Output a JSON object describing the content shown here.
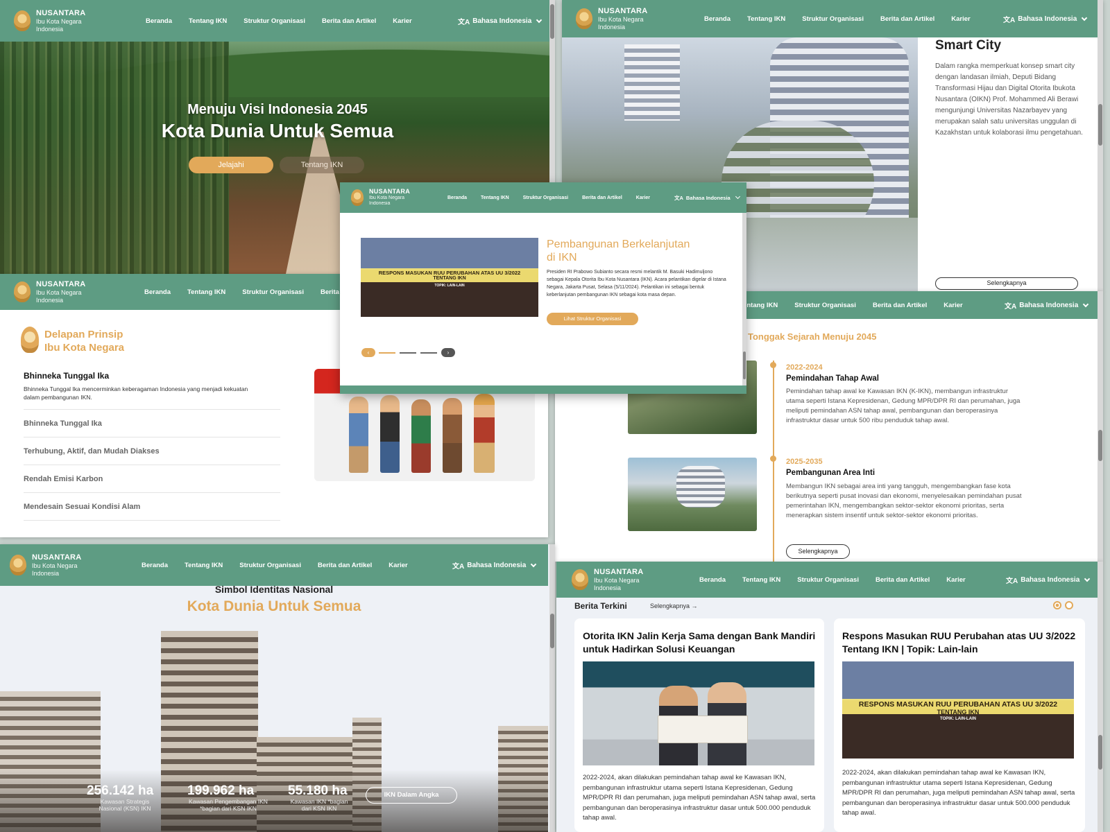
{
  "nav": {
    "logo_title": "NUSANTARA",
    "logo_sub1": "Ibu Kota Negara",
    "logo_sub2": "Indonesia",
    "menu": [
      "Beranda",
      "Tentang IKN",
      "Struktur Organisasi",
      "Berita dan Artikel",
      "Karier"
    ],
    "language": "Bahasa Indonesia"
  },
  "hero": {
    "subtitle": "Menuju Visi Indonesia 2045",
    "title": "Kota Dunia Untuk Semua",
    "primary_button": "Jelajahi",
    "secondary_button": "Tentang IKN"
  },
  "smart_city": {
    "title": "Smart City",
    "body": "Dalam rangka memperkuat konsep smart city dengan landasan ilmiah, Deputi Bidang Transformasi Hijau dan Digital Otorita Ibukota Nusantara (OIKN) Prof. Mohammed Ali Berawi mengunjungi Universitas Nazarbayev yang merupakan salah satu universitas unggulan di Kazakhstan untuk kolaborasi ilmu pengetahuan.",
    "button": "Selengkapnya"
  },
  "pembangunan": {
    "title_line1": "Pembangunan Berkelanjutan",
    "title_line2": "di IKN",
    "body": "Presiden RI Prabowo Subianto secara resmi melantik M. Basuki Hadimuljono sebagai Kepala Otorita Ibu Kota Nusantara (IKN). Acara pelantikan digelar di Istana Negara, Jakarta Pusat, Selasa (5/11/2024). Pelantikan ini sebagai bentuk keberlanjutan pembangunan IKN sebagai kota masa depan.",
    "button": "Lihat Struktur Organisasi",
    "image_caption_line1": "RESPONS MASUKAN RUU PERUBAHAN ATAS UU 3/2022",
    "image_caption_line2": "TENTANG IKN",
    "image_caption_line3": "TOPIK: LAIN-LAIN"
  },
  "prinsip": {
    "heading_line1": "Delapan Prinsip",
    "heading_line2": "Ibu Kota Negara",
    "active_title": "Bhinneka Tunggal Ika",
    "active_body": "Bhinneka Tunggal Ika mencerminkan keberagaman Indonesia yang menjadi kekuatan dalam pembangunan IKN.",
    "items": [
      "Bhinneka Tunggal Ika",
      "Terhubung, Aktif, dan Mudah Diakses",
      "Rendah Emisi Karbon",
      "Mendesain Sesuai Kondisi Alam"
    ]
  },
  "tonggak": {
    "heading": "Tonggak Sejarah Menuju 2045",
    "items": [
      {
        "years": "2022-2024",
        "title": "Pemindahan Tahap Awal",
        "body": "Pemindahan tahap awal ke Kawasan IKN (K-IKN), membangun infrastruktur utama seperti Istana Kepresidenan, Gedung MPR/DPR RI dan perumahan, juga meliputi pemindahan ASN tahap awal, pembangunan dan beroperasinya infrastruktur dasar untuk 500 ribu penduduk tahap awal."
      },
      {
        "years": "2025-2035",
        "title": "Pembangunan Area Inti",
        "body": "Membangun IKN sebagai area inti yang tangguh, mengembangkan fase kota berikutnya seperti pusat inovasi dan ekonomi, menyelesaikan pemindahan pusat pemerintahan IKN, mengembangkan sektor-sektor ekonomi prioritas, serta menerapkan sistem insentif untuk sektor-sektor ekonomi prioritas."
      }
    ],
    "button": "Selengkapnya"
  },
  "simbol": {
    "heading": "Simbol Identitas Nasional",
    "title": "Kota Dunia Untuk Semua",
    "stats": [
      {
        "value": "256.142 ha",
        "label1": "Kawasan Strategis",
        "label2": "Nasional (KSN) IKN"
      },
      {
        "value": "199.962 ha",
        "label1": "Kawasan Pengembangan IKN",
        "label2": "*bagian dari KSN IKN"
      },
      {
        "value": "55.180 ha",
        "label1": "Kawasan IKN *bagian",
        "label2": "dari KSN IKN"
      }
    ],
    "button": "IKN Dalam Angka"
  },
  "berita": {
    "heading": "Berita Terkini",
    "more": "Selengkapnya →",
    "cards": [
      {
        "title": "Otorita IKN Jalin Kerja Sama dengan Bank Mandiri untuk Hadirkan Solusi Keuangan",
        "body": "2022-2024, akan dilakukan pemindahan tahap awal ke Kawasan IKN, pembangunan infrastruktur utama seperti Istana Kepresidenan, Gedung MPR/DPR RI dan perumahan, juga meliputi pemindahan ASN tahap awal, serta pembangunan dan beroperasinya infrastruktur dasar untuk 500.000 penduduk tahap awal."
      },
      {
        "title": "Respons Masukan RUU Perubahan atas UU 3/2022 Tentang IKN | Topik: Lain-lain",
        "body": "2022-2024, akan dilakukan pemindahan tahap awal ke Kawasan IKN, pembangunan infrastruktur utama seperti Istana Kepresidenan, Gedung MPR/DPR RI dan perumahan, juga meliputi pemindahan ASN tahap awal, serta pembangunan dan beroperasinya infrastruktur dasar untuk 500.000 penduduk tahap awal."
      }
    ]
  },
  "colors": {
    "primary": "#5e9c83",
    "accent": "#e2a95a",
    "text": "#222222"
  }
}
